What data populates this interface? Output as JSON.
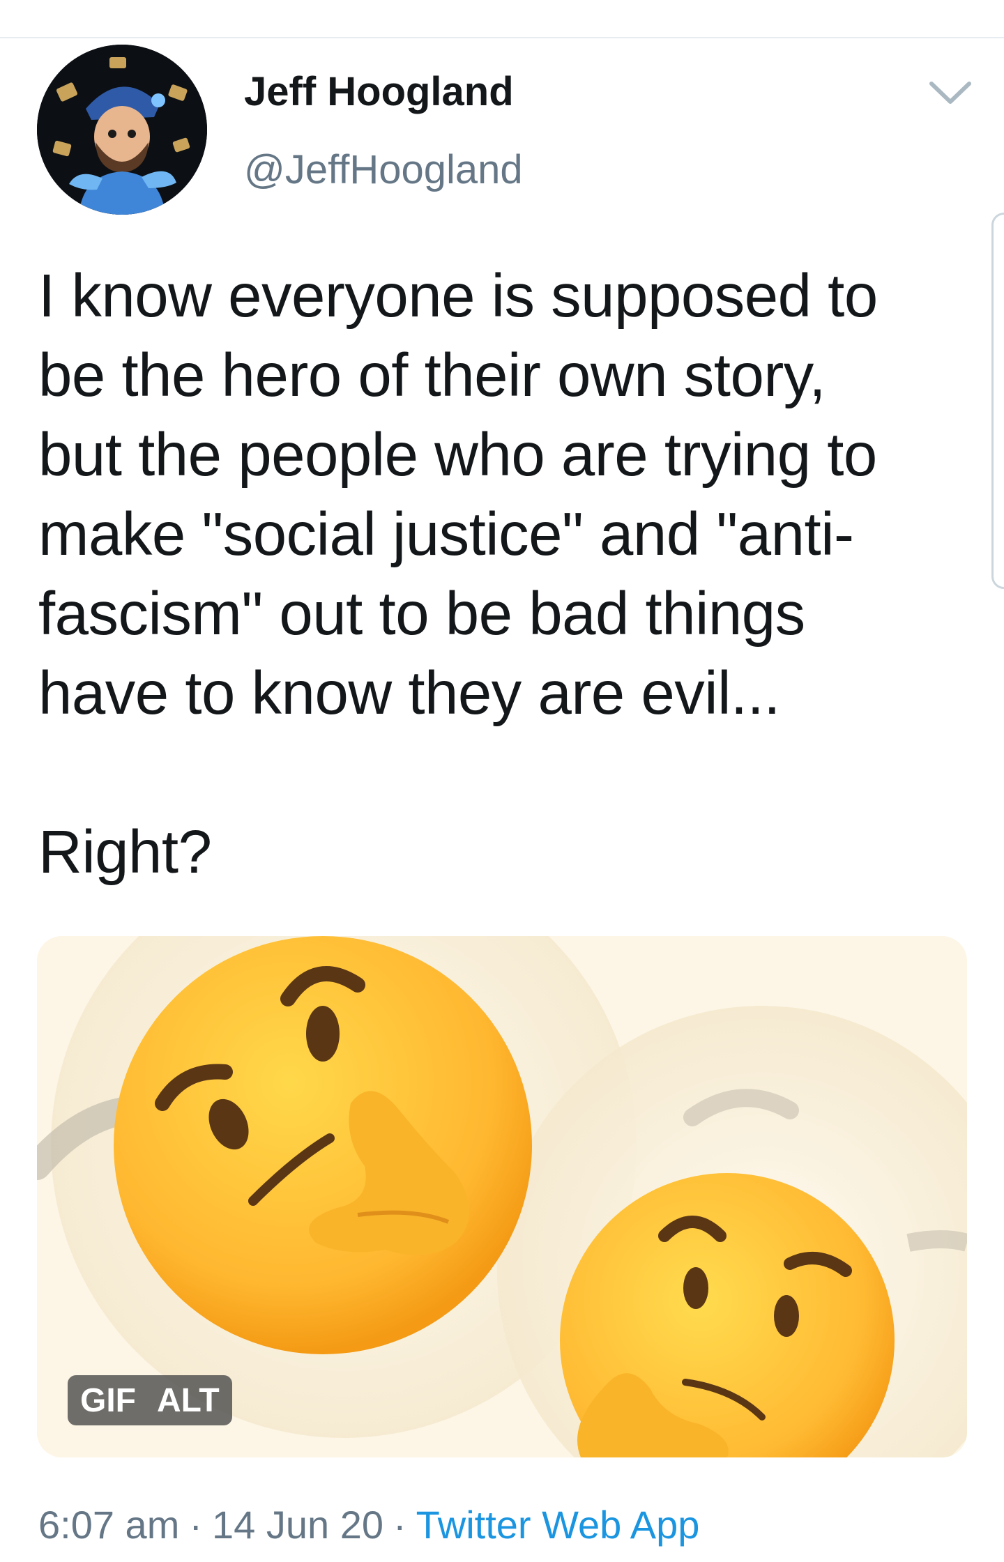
{
  "tweet": {
    "author": {
      "display_name": "Jeff Hoogland",
      "handle": "@JeffHoogland"
    },
    "text": "I know everyone is supposed to\nbe the hero of their own story,\nbut the people who are trying to\nmake \"social justice\" and \"anti-\nfascism\" out to be bad things\nhave to know they are evil...\n\nRight?",
    "media": {
      "type_badge": "GIF",
      "alt_badge": "ALT"
    },
    "meta": {
      "time": "6:07 am",
      "separator": "·",
      "date": "14 Jun 20",
      "source": "Twitter Web App"
    },
    "icons": {
      "menu": "chevron-down-icon",
      "avatar": "avatar-illustration"
    },
    "colors": {
      "text": "#14171a",
      "secondary": "#657786",
      "link": "#1b95e0",
      "divider": "#e6ecf0"
    }
  }
}
